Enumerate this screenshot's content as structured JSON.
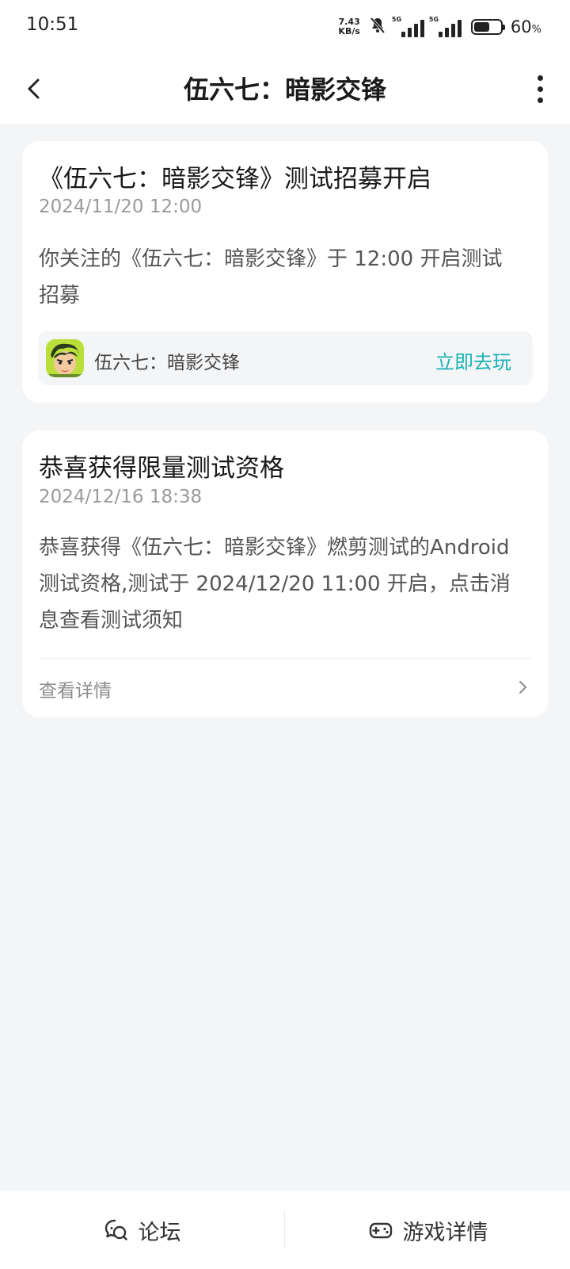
{
  "status_bar": {
    "time": "10:51",
    "net_speed_value": "7.43",
    "net_speed_unit": "KB/s",
    "network_label_1": "5G",
    "network_label_2": "5G",
    "battery_percent": "60",
    "battery_level": 0.6,
    "battery_percent_sign": "%",
    "icons": [
      "mute-icon",
      "signal-icon",
      "signal-icon",
      "battery-icon"
    ]
  },
  "nav": {
    "title": "伍六七：暗影交锋",
    "back_icon": "chevron-left-icon",
    "more_icon": "more-vertical-icon"
  },
  "messages": [
    {
      "title": "《伍六七：暗影交锋》测试招募开启",
      "time": "2024/11/20 12:00",
      "body": "你关注的《伍六七：暗影交锋》于 12:00 开启测试招募",
      "game": {
        "name": "伍六七：暗影交锋",
        "action": "立即去玩",
        "icon": "game-app-icon"
      }
    },
    {
      "title": "恭喜获得限量测试资格",
      "time": "2024/12/16 18:38",
      "body": "恭喜获得《伍六七：暗影交锋》燃剪测试的Android测试资格,测试于 2024/12/20 11:00 开启，点击消息查看测试须知",
      "link_label": "查看详情",
      "link_icon": "chevron-right-icon"
    }
  ],
  "bottom_tabs": [
    {
      "label": "论坛",
      "icon": "forum-chat-icon"
    },
    {
      "label": "游戏详情",
      "icon": "gamepad-icon"
    }
  ],
  "colors": {
    "accent": "#17b3b3",
    "background": "#f4f5f7",
    "card": "#ffffff"
  }
}
